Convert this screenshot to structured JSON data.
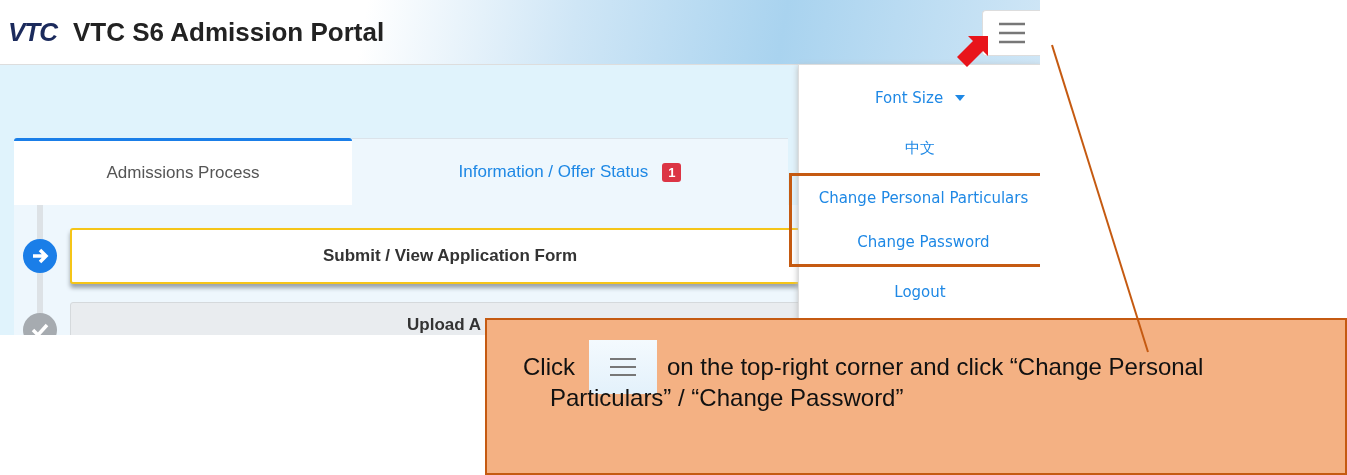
{
  "header": {
    "logo": "VTC",
    "title": "VTC S6 Admission Portal"
  },
  "tabs": [
    {
      "label": "Admissions Process",
      "selected": true
    },
    {
      "label": "Information / Offer Status",
      "selected": false,
      "badge": "1"
    }
  ],
  "steps": [
    {
      "label": "Submit / View Application Form",
      "kind": "current"
    },
    {
      "label": "Upload A",
      "kind": "done"
    }
  ],
  "menu": {
    "items": [
      {
        "label": "Font Size",
        "kind": "dropdown",
        "highlighted": false
      },
      {
        "label": "中文",
        "kind": "link",
        "highlighted": false
      },
      {
        "label": "Change Personal Particulars",
        "kind": "link",
        "highlighted": true
      },
      {
        "label": "Change Password",
        "kind": "link",
        "highlighted": true
      },
      {
        "label": "Logout",
        "kind": "link",
        "highlighted": false
      }
    ]
  },
  "callout": {
    "before": "Click",
    "after": "on the top-right corner and click “Change Personal",
    "continuation": "Particulars” / “Change Password”"
  }
}
